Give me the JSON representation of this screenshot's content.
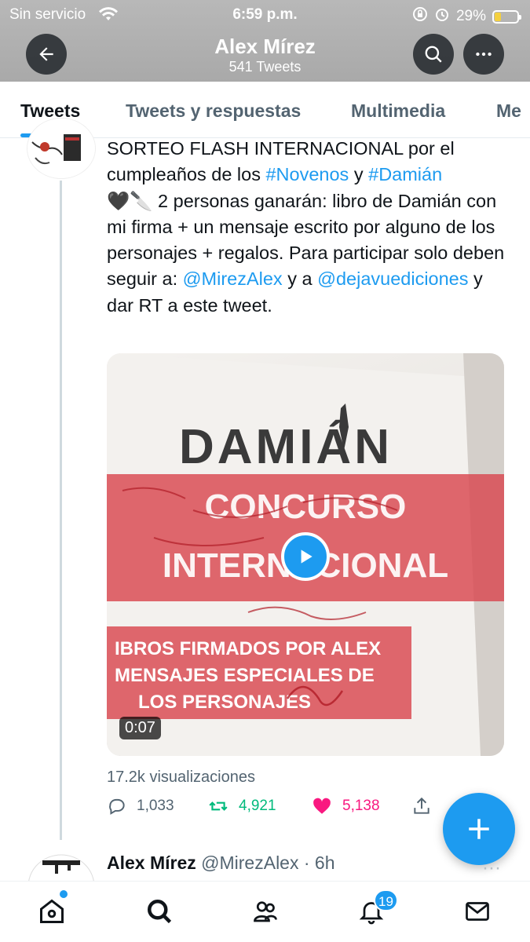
{
  "status_bar": {
    "carrier": "Sin servicio",
    "time": "6:59 p.m.",
    "battery": "29%",
    "battery_level": 0.29
  },
  "header": {
    "name": "Alex Mírez",
    "tweet_count": "541 Tweets"
  },
  "tabs": [
    "Tweets",
    "Tweets y respuestas",
    "Multimedia",
    "Me"
  ],
  "tweet": {
    "text_parts": {
      "p1": "SORTEO FLASH INTERNACIONAL por el cumpleaños de los ",
      "hashtag1": "#Novenos",
      "p2": " y ",
      "hashtag2": "#Damián",
      "p3": "🖤🔪 2 personas ganarán: libro de Damián con mi firma + un mensaje escrito por alguno de los personajes + regalos. Para participar solo deben seguir a: ",
      "mention1": "@MirezAlex",
      "p4": " y a ",
      "mention2": "@dejavuediciones",
      "p5": " y dar RT a este tweet."
    },
    "media": {
      "book_title": "DAMIÁN",
      "banner_line1": "CONCURSO",
      "banner_line2": "INTERNACIONAL",
      "lower_text_1": "IBROS FIRMADOS POR ALEX",
      "lower_text_2": "MENSAJES ESPECIALES DE",
      "lower_text_3": "LOS PERSONAJES",
      "duration": "0:07"
    },
    "views": "17.2k visualizaciones",
    "replies": "1,033",
    "retweets": "4,921",
    "likes": "5,138"
  },
  "next_tweet": {
    "name": "Alex Mírez",
    "handle": "@MirezAlex · 6h"
  },
  "bottom_nav": {
    "notifications_badge": "19"
  },
  "colors": {
    "accent": "#1d9bf0",
    "retweet": "#00ba7c",
    "like": "#f91880",
    "banner_red": "#d9474f"
  }
}
